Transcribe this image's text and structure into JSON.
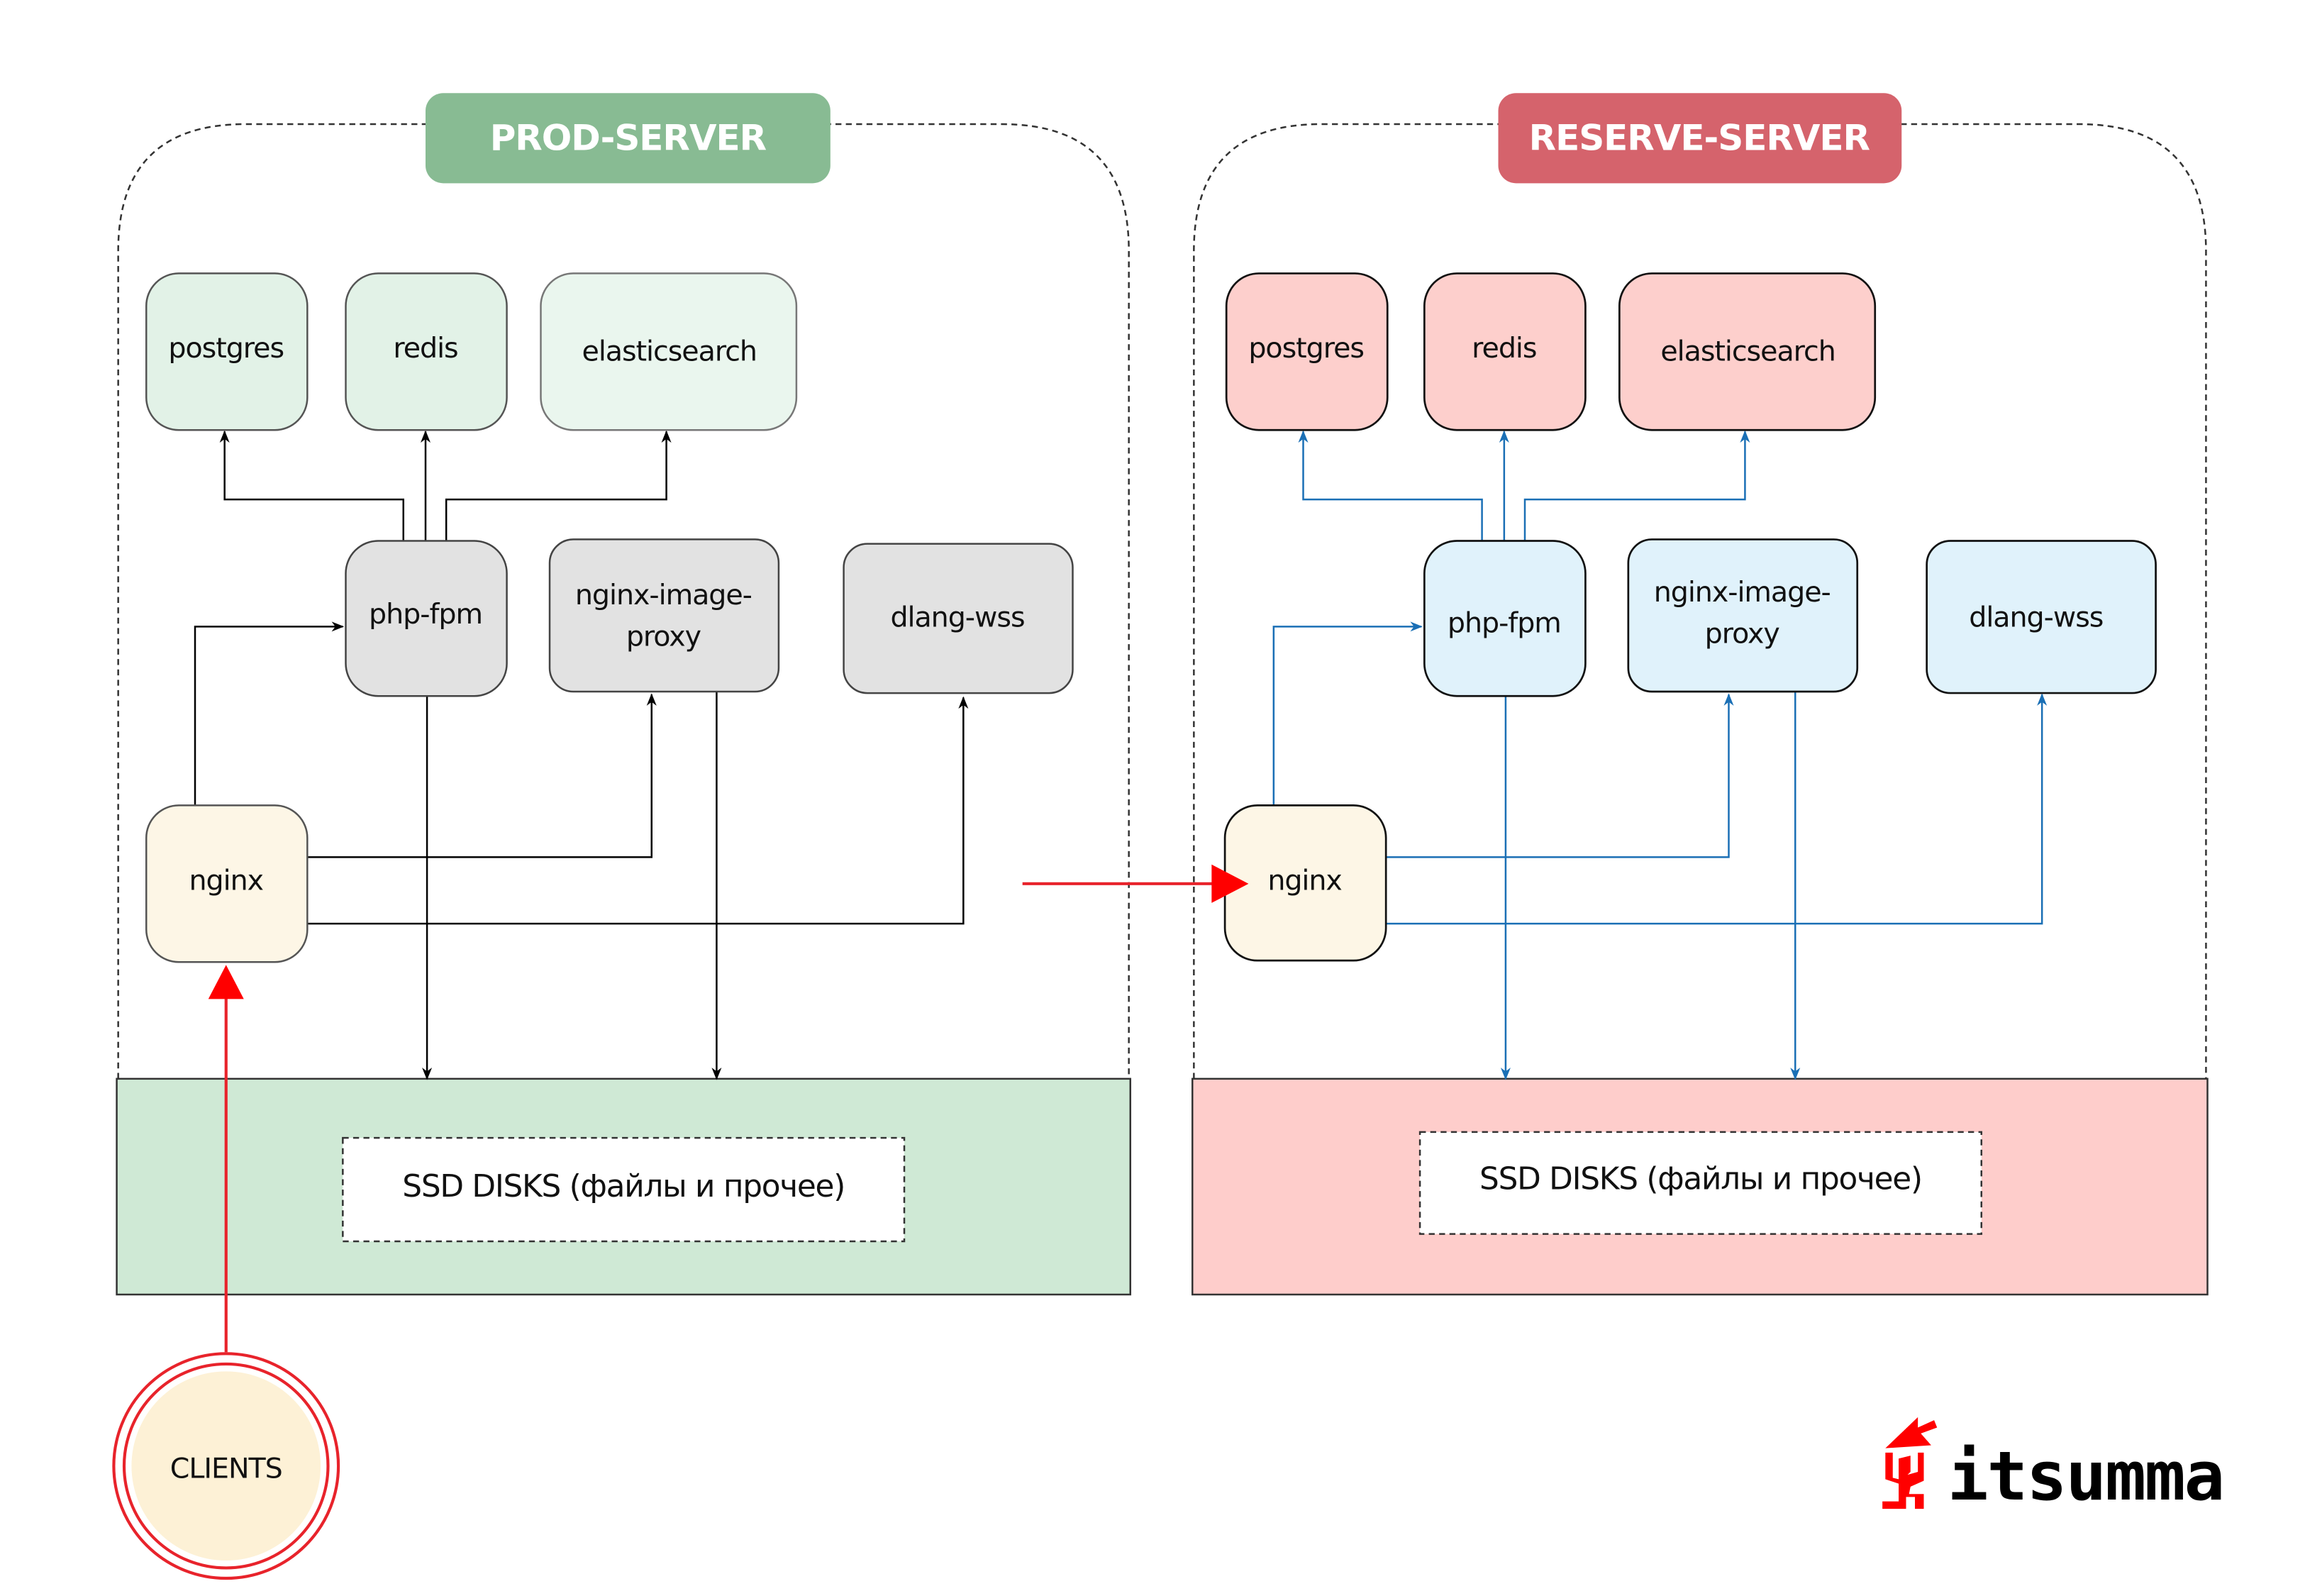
{
  "servers": {
    "prod": {
      "title": "PROD-SERVER",
      "badge_color": "#88bb93",
      "node_fill_db": "#e2f2e7",
      "node_fill_app": "#e2e2e2",
      "storage_fill": "#cfe9d5",
      "edge_color": "#000000",
      "nodes": {
        "postgres": "postgres",
        "redis": "redis",
        "elasticsearch": "elasticsearch",
        "php_fpm": "php-fpm",
        "nginx_image_proxy_line1": "nginx-image-",
        "nginx_image_proxy_line2": "proxy",
        "dlang_wss": "dlang-wss",
        "nginx": "nginx"
      },
      "storage_label": "SSD DISKS (файлы и прочее)"
    },
    "reserve": {
      "title": "RESERVE-SERVER",
      "badge_color": "#d5636c",
      "node_fill_db": "#fdcfcc",
      "node_fill_app": "#e0f2fb",
      "storage_fill": "#fecdcb",
      "edge_color": "#1a6fb5",
      "nodes": {
        "postgres": "postgres",
        "redis": "redis",
        "elasticsearch": "elasticsearch",
        "php_fpm": "php-fpm",
        "nginx_image_proxy_line1": "nginx-image-",
        "nginx_image_proxy_line2": "proxy",
        "dlang_wss": "dlang-wss",
        "nginx": "nginx"
      },
      "storage_label": "SSD DISKS (файлы и прочее)"
    }
  },
  "clients": {
    "label": "CLIENTS",
    "fill": "#fdf1d6",
    "ring_color": "#e8232b"
  },
  "nginx_fill": "#fdf6e6",
  "failover_arrow_color": "#e8232b",
  "logo": {
    "text": "itsumma",
    "mark_color": "#ff0000"
  }
}
